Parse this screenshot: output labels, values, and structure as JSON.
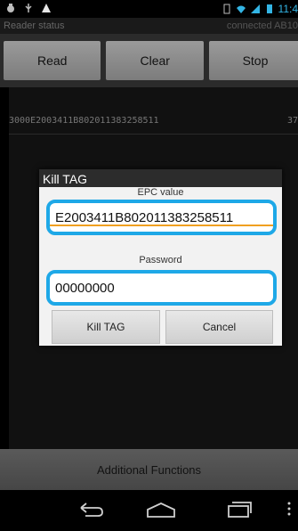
{
  "status_bar": {
    "time": "11:4",
    "icons": [
      "bug-icon",
      "usb-icon",
      "warning-icon",
      "vibrate-icon",
      "wifi-icon",
      "signal-icon",
      "battery-icon"
    ]
  },
  "reader": {
    "label": "Reader status",
    "connection": "connected AB10"
  },
  "toolbar": {
    "read_label": "Read",
    "clear_label": "Clear",
    "stop_label": "Stop"
  },
  "tag_list": [
    {
      "epc": "3000E2003411B802011383258511",
      "count": "37"
    }
  ],
  "dialog": {
    "title": "Kill TAG",
    "epc_label": "EPC value",
    "epc_value": "E2003411B802011383258511",
    "password_label": "Password",
    "password_value": "00000000",
    "kill_label": "Kill TAG",
    "cancel_label": "Cancel"
  },
  "footer": {
    "additional_label": "Additional Functions"
  },
  "colors": {
    "accent": "#1ea8e7",
    "focus_underline": "#f0a020",
    "time_color": "#33b5e5"
  }
}
